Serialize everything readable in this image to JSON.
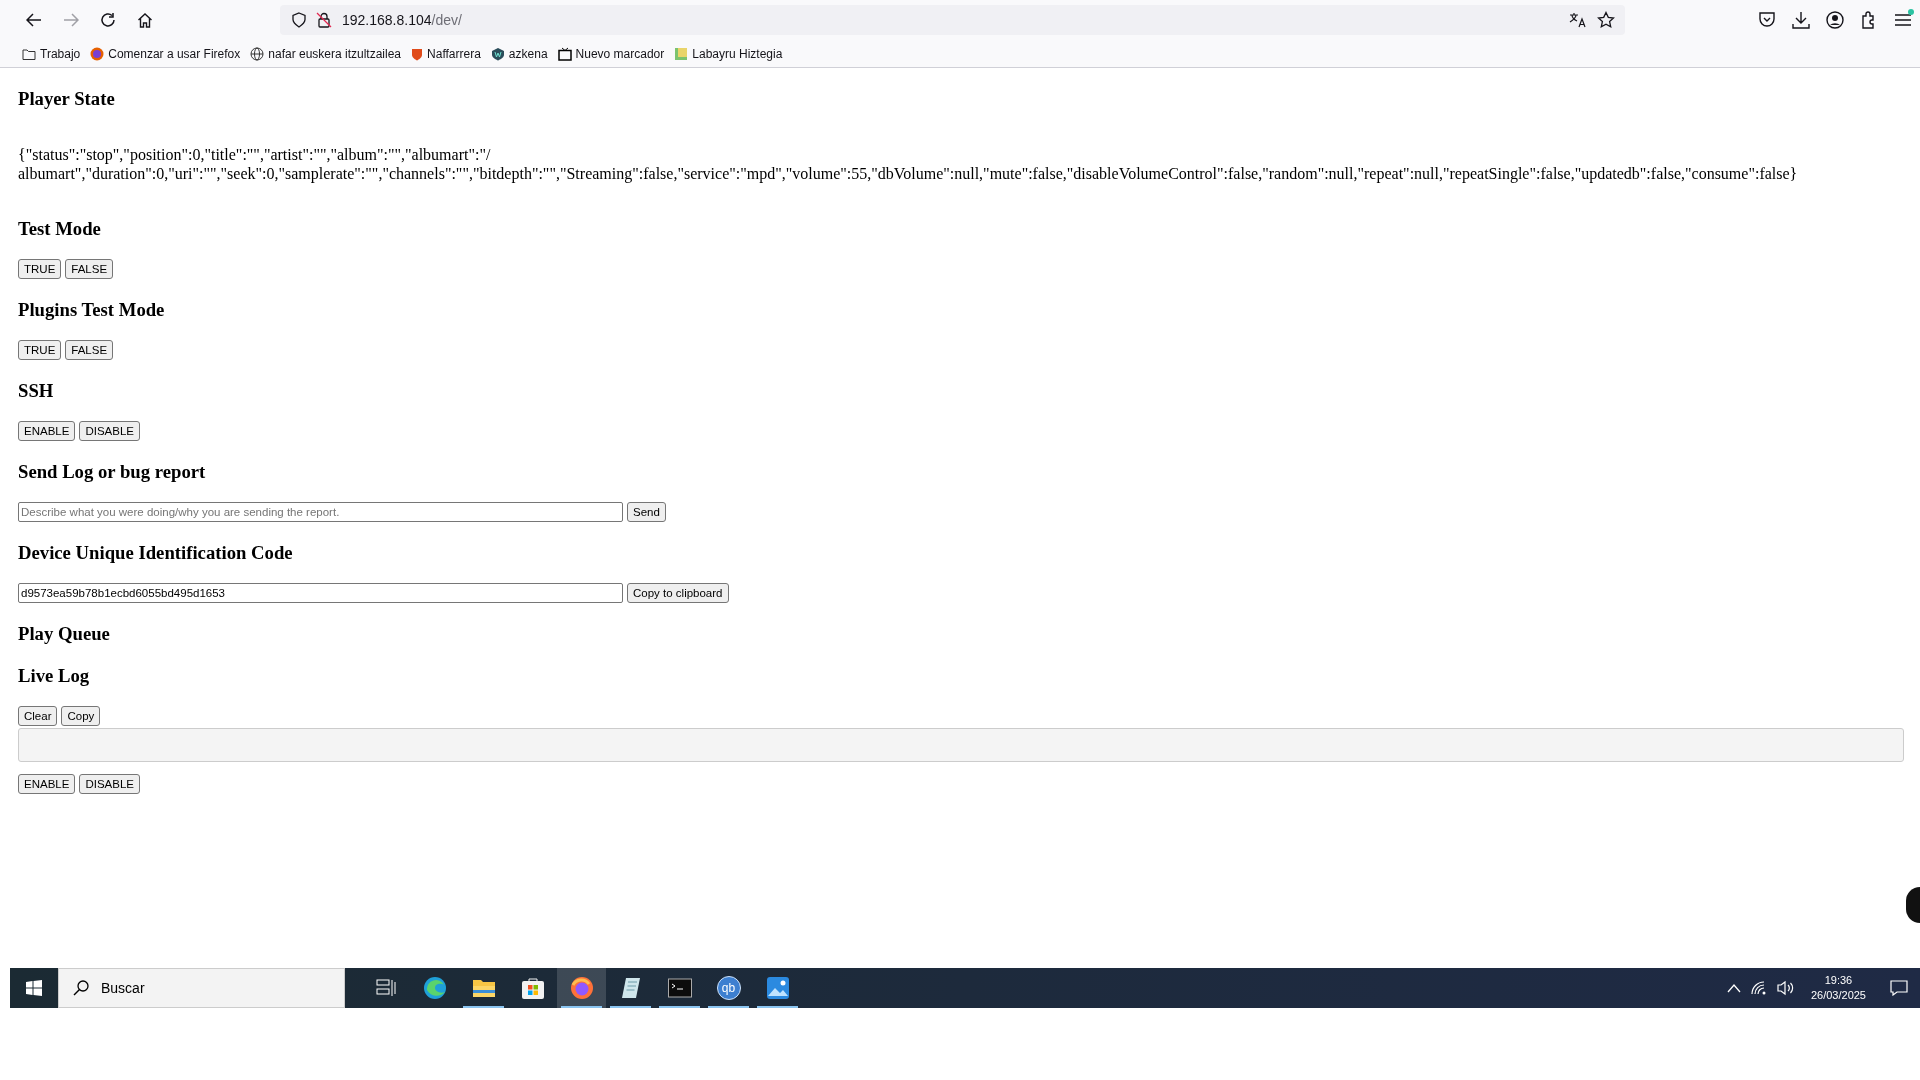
{
  "browser": {
    "address": {
      "host": "192.168.8.104",
      "path": "/dev/"
    },
    "bookmarks": [
      {
        "label": "Trabajo",
        "kind": "folder"
      },
      {
        "label": "Comenzar a usar Firefox",
        "kind": "firefox"
      },
      {
        "label": "nafar euskera itzultzailea",
        "kind": "globe"
      },
      {
        "label": "Naffarrera",
        "kind": "shield"
      },
      {
        "label": "azkena",
        "kind": "badge"
      },
      {
        "label": "Nuevo marcador",
        "kind": "tv"
      },
      {
        "label": "Labayru Hiztegia",
        "kind": "book"
      }
    ]
  },
  "page": {
    "sections": [
      {
        "heading": "Player State",
        "rows": [
          {
            "kind": "text",
            "text": "{\"status\":\"stop\",\"position\":0,\"title\":\"\",\"artist\":\"\",\"album\":\"\",\"albumart\":\"/\nalbumart\",\"duration\":0,\"uri\":\"\",\"seek\":0,\"samplerate\":\"\",\"channels\":\"\",\"bitdepth\":\"\",\"Streaming\":false,\"service\":\"mpd\",\"volume\":55,\"dbVolume\":null,\"mute\":false,\"disableVolumeControl\":false,\"random\":null,\"repeat\":null,\"repeatSingle\":false,\"updatedb\":false,\"consume\":false}"
          }
        ]
      },
      {
        "heading": "Test Mode",
        "rows": [
          {
            "kind": "buttons",
            "buttons": [
              "TRUE",
              "FALSE"
            ]
          }
        ]
      },
      {
        "heading": "Plugins Test Mode",
        "rows": [
          {
            "kind": "buttons",
            "buttons": [
              "TRUE",
              "FALSE"
            ]
          }
        ]
      },
      {
        "heading": "SSH",
        "rows": [
          {
            "kind": "buttons",
            "buttons": [
              "ENABLE",
              "DISABLE"
            ]
          }
        ]
      },
      {
        "heading": "Send Log or bug report",
        "rows": [
          {
            "kind": "field",
            "placeholder": "Describe what you were doing/why you are sending the report.",
            "button": "Send"
          }
        ]
      },
      {
        "heading": "Device Unique Identification Code",
        "rows": [
          {
            "kind": "field",
            "value": "d9573ea59b78b1ecbd6055bd495d1653",
            "button": "Copy to clipboard"
          }
        ]
      },
      {
        "heading": "Play Queue"
      },
      {
        "heading": "Live Log",
        "rows": [
          {
            "kind": "buttons",
            "buttons": [
              "Clear",
              "Copy"
            ]
          },
          {
            "kind": "log"
          },
          {
            "kind": "buttons",
            "buttons": [
              "ENABLE",
              "DISABLE"
            ]
          }
        ]
      }
    ]
  },
  "taskbar": {
    "search": {
      "placeholder": "Buscar"
    },
    "apps": [
      {
        "kind": "task-view",
        "running": false,
        "selected": false
      },
      {
        "kind": "edge",
        "running": false,
        "selected": false
      },
      {
        "kind": "explorer",
        "running": true,
        "selected": false
      },
      {
        "kind": "store",
        "running": false,
        "selected": false
      },
      {
        "kind": "firefox",
        "running": true,
        "selected": true
      },
      {
        "kind": "notepad",
        "running": true,
        "selected": false
      },
      {
        "kind": "terminal",
        "running": true,
        "selected": false
      },
      {
        "kind": "qbittorrent",
        "label": "qb",
        "running": true,
        "selected": false
      },
      {
        "kind": "photos",
        "running": true,
        "selected": false
      }
    ],
    "clock": {
      "time": "19:36",
      "date": "26/03/2025"
    }
  }
}
